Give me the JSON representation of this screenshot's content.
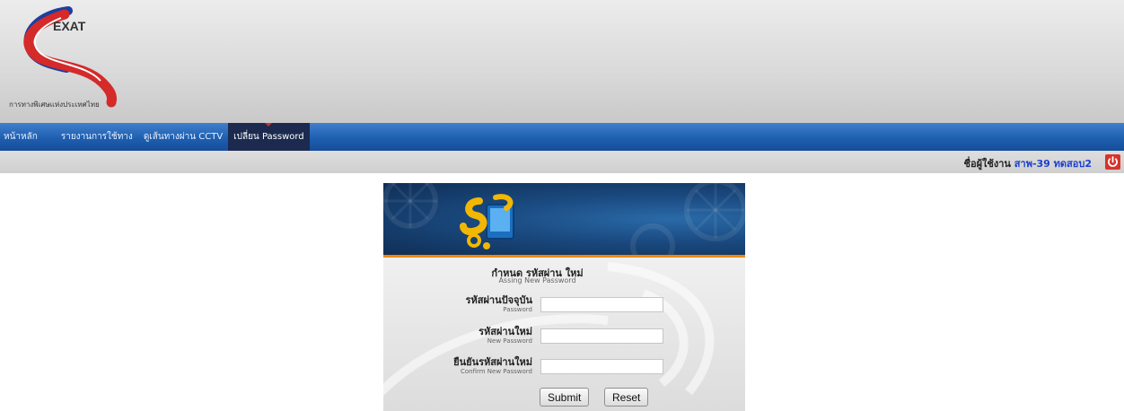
{
  "header": {
    "logo_text": "EXAT",
    "logo_subtitle": "การทางพิเศษแห่งประเทศไทย"
  },
  "nav": {
    "items": [
      {
        "label": "หน้าหลัก"
      },
      {
        "label": "รายงานการใช้ทาง"
      },
      {
        "label": "ดูเส้นทางผ่าน CCTV"
      },
      {
        "label": "เปลี่ยน Password"
      }
    ],
    "active_index": 3
  },
  "userbar": {
    "label": "ชื่อผู้ใช้งาน",
    "username": "สาพ-39 ทดสอบ2"
  },
  "form": {
    "title_th": "กำหนด รหัสผ่าน ใหม่",
    "title_en": "Assing New Password",
    "fields": [
      {
        "label_th": "รหัสผ่านปัจจุบัน",
        "label_en": "Password",
        "value": ""
      },
      {
        "label_th": "รหัสผ่านใหม่",
        "label_en": "New Password",
        "value": ""
      },
      {
        "label_th": "ยืนยันรหัสผ่านใหม่",
        "label_en": "Confirm New Password",
        "value": ""
      }
    ],
    "submit_label": "Submit",
    "reset_label": "Reset"
  },
  "colors": {
    "nav_blue": "#1f5fb0",
    "nav_active": "#1b2a4e",
    "accent_orange": "#f08a00",
    "power_red": "#d8322a",
    "username_blue": "#1a3fd0"
  },
  "icons": {
    "power": "power-icon",
    "logo": "exat-logo"
  }
}
